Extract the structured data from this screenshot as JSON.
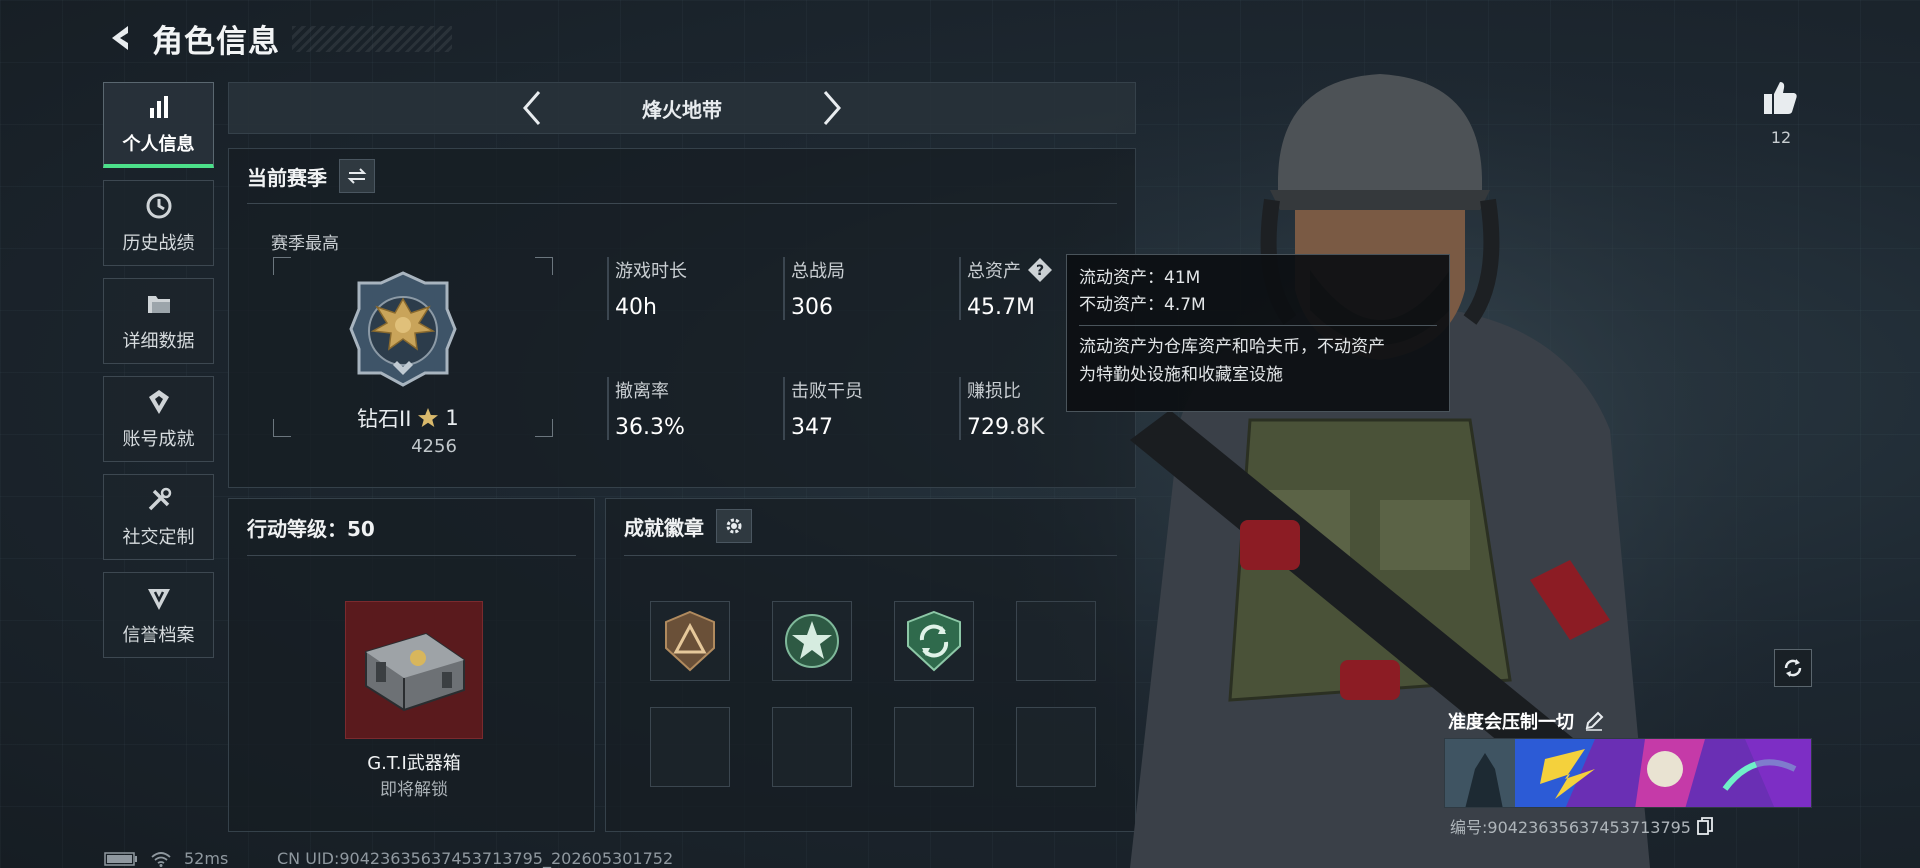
{
  "header": {
    "title": "角色信息"
  },
  "sidebar": {
    "items": [
      {
        "label": "个人信息",
        "icon": "bar-chart-icon",
        "active": true
      },
      {
        "label": "历史战绩",
        "icon": "history-icon"
      },
      {
        "label": "详细数据",
        "icon": "folder-icon"
      },
      {
        "label": "账号成就",
        "icon": "achievement-icon"
      },
      {
        "label": "社交定制",
        "icon": "tools-icon"
      },
      {
        "label": "信誉档案",
        "icon": "shield-icon"
      }
    ]
  },
  "map_selector": {
    "name": "烽火地带"
  },
  "season": {
    "title": "当前赛季",
    "best_label": "赛季最高",
    "rank_name": "钻石II",
    "rank_stars": "1",
    "rank_score": "4256",
    "stats": [
      {
        "label": "游戏时长",
        "value": "40h"
      },
      {
        "label": "总战局",
        "value": "306"
      },
      {
        "label": "总资产",
        "value": "45.7M"
      },
      {
        "label": "撤离率",
        "value": "36.3%"
      },
      {
        "label": "击败干员",
        "value": "347"
      },
      {
        "label": "赚损比",
        "value": "729.8K"
      }
    ]
  },
  "tooltip": {
    "line1": "流动资产：41M",
    "line2": "不动资产：4.7M",
    "note1": "流动资产为仓库资产和哈夫币，不动资产",
    "note2": "为特勤处设施和收藏室设施"
  },
  "level": {
    "title": "行动等级：50",
    "reward_name": "G.T.I武器箱",
    "reward_status": "即将解锁"
  },
  "badges": {
    "title": "成就徽章"
  },
  "profile": {
    "likes": "12",
    "name": "准度会压制一切",
    "id": "编号:9042363563745371379​5"
  },
  "footer": {
    "ping": "52ms",
    "uid": "CN UID:90423635637453713795_202605301752"
  },
  "colors": {
    "accent": "#4ce08a",
    "crate_bg": "#5a1a1d",
    "panel_border": "#35414a"
  }
}
